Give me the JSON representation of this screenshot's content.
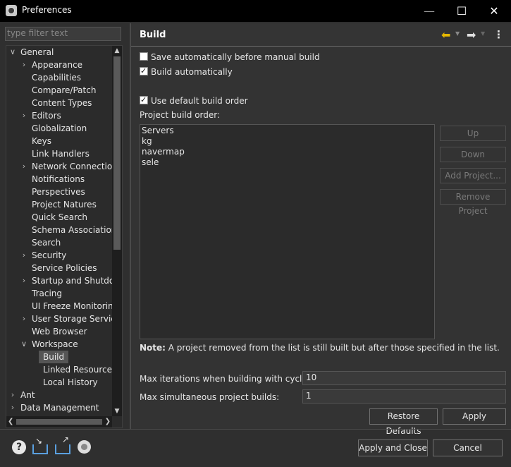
{
  "window": {
    "title": "Preferences"
  },
  "filter": {
    "placeholder": "type filter text"
  },
  "tree": [
    {
      "label": "General",
      "level": 0,
      "toggle": "v"
    },
    {
      "label": "Appearance",
      "level": 1,
      "toggle": ">"
    },
    {
      "label": "Capabilities",
      "level": 1,
      "toggle": ""
    },
    {
      "label": "Compare/Patch",
      "level": 1,
      "toggle": ""
    },
    {
      "label": "Content Types",
      "level": 1,
      "toggle": ""
    },
    {
      "label": "Editors",
      "level": 1,
      "toggle": ">"
    },
    {
      "label": "Globalization",
      "level": 1,
      "toggle": ""
    },
    {
      "label": "Keys",
      "level": 1,
      "toggle": ""
    },
    {
      "label": "Link Handlers",
      "level": 1,
      "toggle": ""
    },
    {
      "label": "Network Connections",
      "level": 1,
      "toggle": ">"
    },
    {
      "label": "Notifications",
      "level": 1,
      "toggle": ""
    },
    {
      "label": "Perspectives",
      "level": 1,
      "toggle": ""
    },
    {
      "label": "Project Natures",
      "level": 1,
      "toggle": ""
    },
    {
      "label": "Quick Search",
      "level": 1,
      "toggle": ""
    },
    {
      "label": "Schema Associations",
      "level": 1,
      "toggle": ""
    },
    {
      "label": "Search",
      "level": 1,
      "toggle": ""
    },
    {
      "label": "Security",
      "level": 1,
      "toggle": ">"
    },
    {
      "label": "Service Policies",
      "level": 1,
      "toggle": ""
    },
    {
      "label": "Startup and Shutdown",
      "level": 1,
      "toggle": ">"
    },
    {
      "label": "Tracing",
      "level": 1,
      "toggle": ""
    },
    {
      "label": "UI Freeze Monitoring",
      "level": 1,
      "toggle": ""
    },
    {
      "label": "User Storage Service",
      "level": 1,
      "toggle": ">"
    },
    {
      "label": "Web Browser",
      "level": 1,
      "toggle": ""
    },
    {
      "label": "Workspace",
      "level": 1,
      "toggle": "v"
    },
    {
      "label": "Build",
      "level": 2,
      "toggle": "",
      "selected": true
    },
    {
      "label": "Linked Resources",
      "level": 2,
      "toggle": ""
    },
    {
      "label": "Local History",
      "level": 2,
      "toggle": ""
    },
    {
      "label": "Ant",
      "level": 0,
      "toggle": ">"
    },
    {
      "label": "Data Management",
      "level": 0,
      "toggle": ">"
    }
  ],
  "page": {
    "title": "Build",
    "save_auto": {
      "label": "Save automatically before manual build",
      "checked": false
    },
    "build_auto": {
      "label": "Build automatically",
      "checked": true
    },
    "default_order": {
      "label": "Use default build order",
      "checked": true
    },
    "order_label": "Project build order:",
    "projects": [
      "Servers",
      "kg",
      "navermap",
      "sele"
    ],
    "buttons": {
      "up": "Up",
      "down": "Down",
      "add": "Add Project...",
      "remove": "Remove Project"
    },
    "note_prefix": "Note:",
    "note_text": " A project removed from the list is still built but after those specified in the list.",
    "max_iter_label": "Max iterations when building with cycles:",
    "max_iter_value": "10",
    "max_sim_label": "Max simultaneous project builds:",
    "max_sim_value": "1",
    "restore_defaults": "Restore Defaults",
    "apply": "Apply"
  },
  "footer": {
    "apply_close": "Apply and Close",
    "cancel": "Cancel"
  },
  "icons": {
    "help": "help-icon",
    "import": "import-icon",
    "export": "export-icon",
    "oomph": "oomph-icon",
    "back": "back-arrow-icon",
    "forward": "forward-arrow-icon",
    "menu": "view-menu-icon"
  },
  "colors": {
    "background": "#2f2f2f",
    "titlebar": "#000000",
    "back_arrow": "#e6b800"
  }
}
